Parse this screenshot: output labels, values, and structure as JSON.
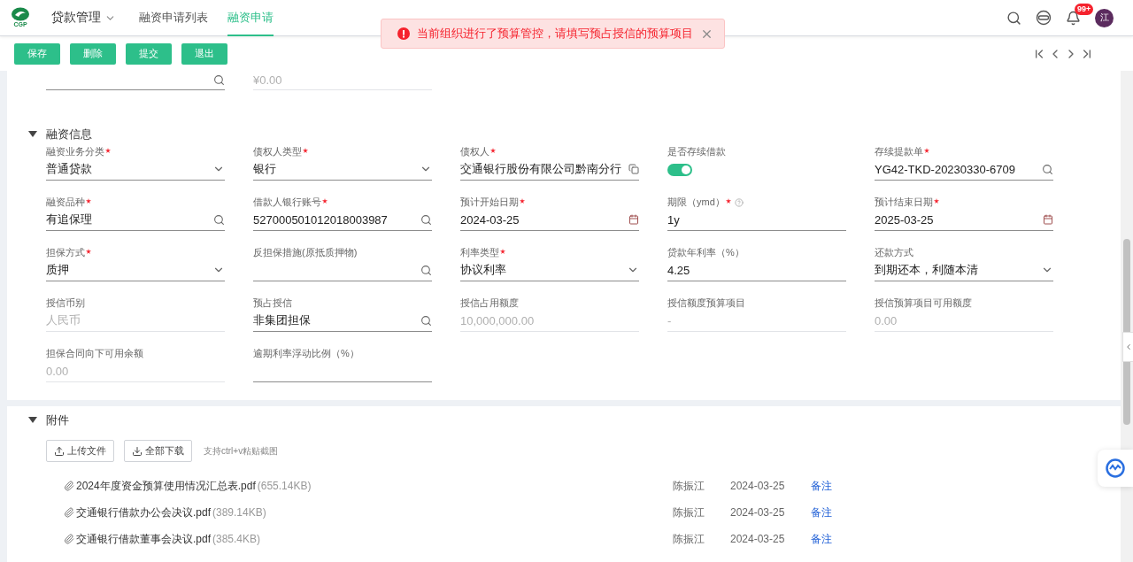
{
  "header": {
    "logo_text": "CGP",
    "module": "贷款管理",
    "tabs": [
      {
        "label": "融资申请列表",
        "selected": false
      },
      {
        "label": "融资申请",
        "selected": true
      }
    ],
    "notification_badge": "99+",
    "avatar": "江"
  },
  "toast": {
    "message": "当前组织进行了预算管控，请填写预占授信的预算项目"
  },
  "toolbar": {
    "buttons": [
      "保存",
      "删除",
      "提交",
      "退出"
    ]
  },
  "top_fields": [
    {
      "kind": "search"
    },
    {
      "kind": "text",
      "value": "¥0.00",
      "disabled": true
    }
  ],
  "finance_section": {
    "title": "融资信息",
    "expanded": true,
    "fields": [
      {
        "label": "融资业务分类",
        "required": true,
        "kind": "select",
        "value": "普通贷款"
      },
      {
        "label": "债权人类型",
        "required": true,
        "kind": "select",
        "value": "银行"
      },
      {
        "label": "债权人",
        "required": true,
        "kind": "copy",
        "value": "交通银行股份有限公司黔南分行"
      },
      {
        "label": "是否存续借款",
        "kind": "toggle",
        "on": true
      },
      {
        "label": "存续提款单",
        "required": true,
        "kind": "search",
        "value": "YG42-TKD-20230330-6709"
      },
      {
        "label": "融资品种",
        "required": true,
        "kind": "search",
        "value": "有追保理"
      },
      {
        "label": "借款人银行账号",
        "required": true,
        "kind": "search",
        "value": "527000501012018003987"
      },
      {
        "label": "预计开始日期",
        "required": true,
        "kind": "date",
        "value": "2024-03-25"
      },
      {
        "label": "期限（ymd）",
        "required": true,
        "help": true,
        "kind": "text",
        "value": "1y"
      },
      {
        "label": "预计结束日期",
        "required": true,
        "kind": "date",
        "value": "2025-03-25"
      },
      {
        "label": "担保方式",
        "required": true,
        "kind": "select",
        "value": "质押"
      },
      {
        "label": "反担保措施(原抵质押物)",
        "kind": "search"
      },
      {
        "label": "利率类型",
        "required": true,
        "kind": "select",
        "value": "协议利率"
      },
      {
        "label": "贷款年利率（%）",
        "kind": "text",
        "value": "4.25"
      },
      {
        "label": "还款方式",
        "kind": "select",
        "value": "到期还本，利随本清"
      },
      {
        "label": "授信币别",
        "kind": "text",
        "value": "人民币",
        "disabled": true
      },
      {
        "label": "预占授信",
        "kind": "search",
        "value": "非集团担保"
      },
      {
        "label": "授信占用额度",
        "kind": "text",
        "value": "10,000,000.00",
        "disabled": true
      },
      {
        "label": "授信额度预算项目",
        "kind": "text",
        "value": "-",
        "disabled": true
      },
      {
        "label": "授信预算项目可用额度",
        "kind": "text",
        "value": "0.00",
        "disabled": true
      },
      {
        "label": "担保合同向下可用余额",
        "kind": "text",
        "value": "0.00",
        "disabled": true
      },
      {
        "label": "逾期利率浮动比例（%）",
        "kind": "text"
      }
    ]
  },
  "attachments": {
    "title": "附件",
    "expanded": true,
    "buttons": [
      {
        "label": "上传文件",
        "kind": "upload"
      },
      {
        "label": "全部下载",
        "kind": "download"
      }
    ],
    "hint": "支持ctrl+v粘贴截图",
    "files": [
      {
        "name": "2024年度资金预算使用情况汇总表.pdf",
        "size": "(655.14KB)",
        "uploader": "陈振江",
        "date": "2024-03-25",
        "action": "备注"
      },
      {
        "name": "交通银行借款办公会决议.pdf",
        "size": "(389.14KB)",
        "uploader": "陈振江",
        "date": "2024-03-25",
        "action": "备注"
      },
      {
        "name": "交通银行借款董事会决议.pdf",
        "size": "(385.4KB)",
        "uploader": "陈振江",
        "date": "2024-03-25",
        "action": "备注"
      }
    ]
  }
}
